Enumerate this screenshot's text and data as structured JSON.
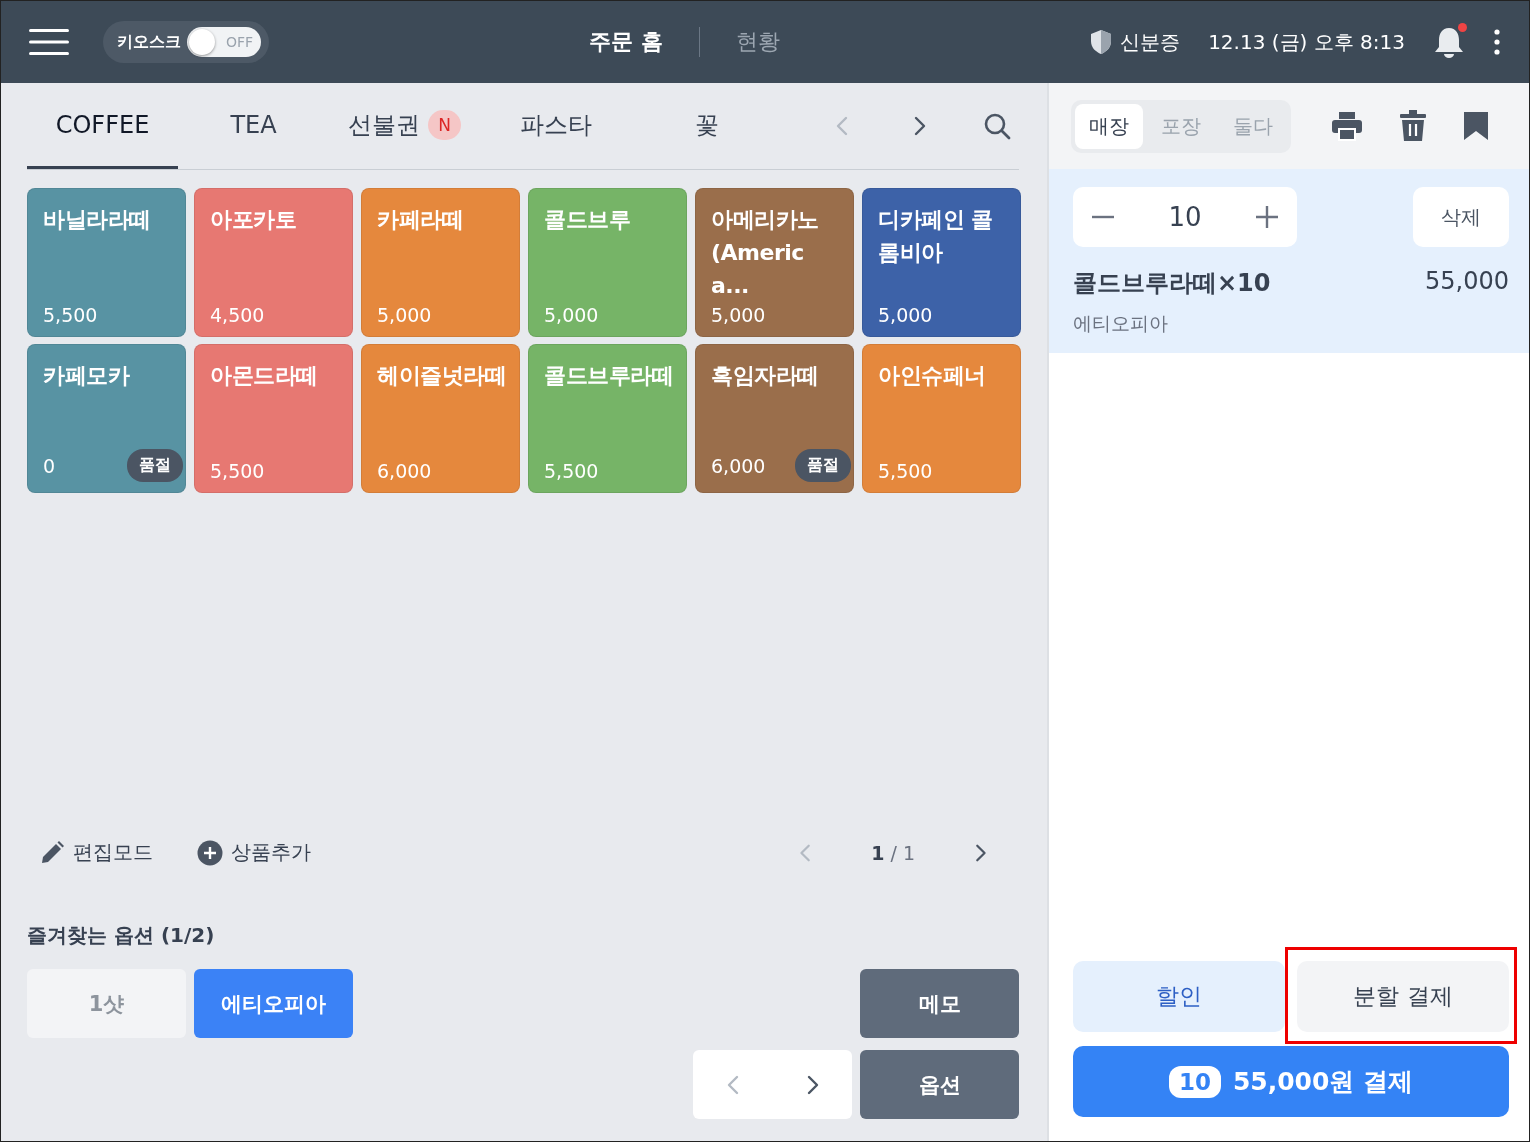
{
  "header": {
    "kiosk": {
      "label": "키오스크",
      "on": false,
      "state_label": "OFF"
    },
    "nav": [
      {
        "label": "주문 홈",
        "selected": true
      },
      {
        "label": "현황",
        "selected": false
      }
    ],
    "id_label": "신분증",
    "datetime": "12.13 (금) 오후 8:13",
    "notification_unread": true
  },
  "categories": [
    {
      "label": "COFFEE",
      "selected": true
    },
    {
      "label": "TEA",
      "selected": false
    },
    {
      "label": "선불권",
      "selected": false,
      "badge": "N"
    },
    {
      "label": "파스타",
      "selected": false
    },
    {
      "label": "꽃",
      "selected": false
    }
  ],
  "products": [
    {
      "name": "바닐라라떼",
      "price": "5,500",
      "color": "#5893a3"
    },
    {
      "name": "아포카토",
      "price": "4,500",
      "color": "#e77872"
    },
    {
      "name": "카페라떼",
      "price": "5,000",
      "color": "#e5883d"
    },
    {
      "name": "콜드브루",
      "price": "5,000",
      "color": "#76b467"
    },
    {
      "name": "아메리카노 (America...",
      "price": "5,000",
      "color": "#9a6e4b"
    },
    {
      "name": "디카페인 콜롬비아",
      "price": "5,000",
      "color": "#3d62a8"
    },
    {
      "name": "카페모카",
      "price": "0",
      "color": "#5893a3",
      "badge": "품절"
    },
    {
      "name": "아몬드라떼",
      "price": "5,500",
      "color": "#e77872"
    },
    {
      "name": "헤이즐넛라떼",
      "price": "6,000",
      "color": "#e5883d"
    },
    {
      "name": "콜드브루라떼",
      "price": "5,500",
      "color": "#76b467"
    },
    {
      "name": "흑임자라떼",
      "price": "6,000",
      "color": "#9a6e4b",
      "badge": "품절"
    },
    {
      "name": "아인슈페너",
      "price": "5,500",
      "color": "#e5883d"
    }
  ],
  "tools": [
    {
      "kind": "edit",
      "label": "편집모드"
    },
    {
      "kind": "add",
      "label": "상품추가"
    }
  ],
  "pagination": {
    "current": "1",
    "separator": "/",
    "total": "1"
  },
  "favorites": {
    "title": "즐겨찾는 옵션 (1/2)",
    "options": [
      {
        "label": "1샷",
        "selected": false
      },
      {
        "label": "에티오피아",
        "selected": true
      }
    ]
  },
  "side_buttons": [
    "메모",
    "옵션"
  ],
  "order_types": [
    {
      "label": "매장",
      "selected": true
    },
    {
      "label": "포장",
      "selected": false
    },
    {
      "label": "둘다",
      "selected": false
    }
  ],
  "order_items": [
    {
      "quantity": "10",
      "delete_label": "삭제",
      "name": "콜드브루라떼×10",
      "price": "55,000",
      "option": "에티오피아",
      "selected": true
    }
  ],
  "discount_label": "할인",
  "split_payment": {
    "label": "분할 결제",
    "highlighted": true
  },
  "pay": {
    "count": "10",
    "label": "55,000원 결제"
  }
}
